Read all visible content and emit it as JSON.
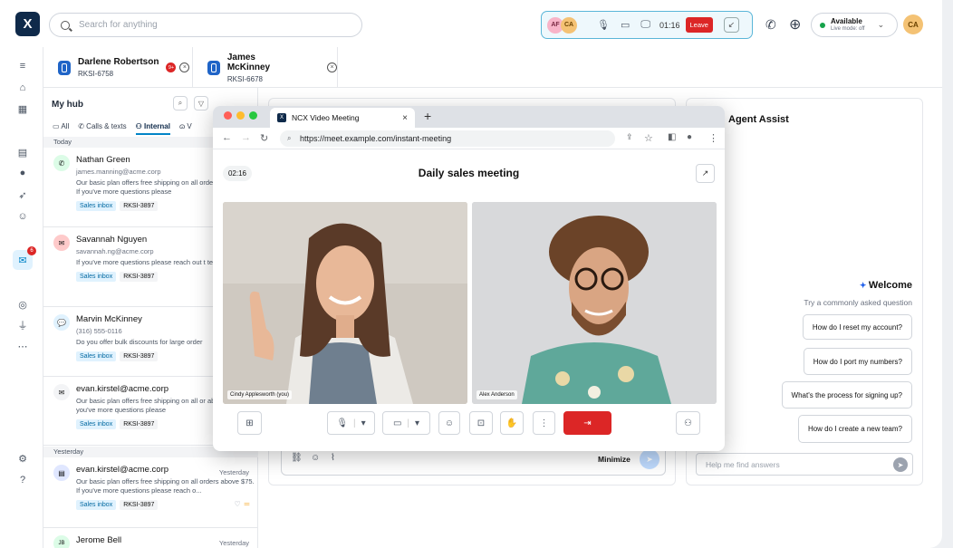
{
  "top": {
    "search_placeholder": "Search for anything",
    "call_avatars": [
      "AF",
      "CA"
    ],
    "timer": "01:16",
    "leave": "Leave",
    "status": "Available",
    "status_sub": "Live mode: off",
    "me": "CA",
    "logo": "X"
  },
  "rail": {
    "badge": "6"
  },
  "contacts": [
    {
      "name": "Darlene Robertson",
      "id": "RKSI-6758",
      "notif": "9+"
    },
    {
      "name": "James McKinney",
      "id": "RKSI-6678"
    }
  ],
  "hub": {
    "title": "My hub",
    "filters": [
      "All",
      "Calls & texts",
      "Internal",
      "V"
    ],
    "today": "Today",
    "yesterday": "Yesterday",
    "items": [
      {
        "name": "Nathan Green",
        "meta": "james.manning@acme.corp",
        "body": "Our basic plan offers free shipping on all orders above $75. If you've more questions please",
        "tags": [
          "Sales inbox",
          "RKSI-3897"
        ],
        "color": "#dcfce7"
      },
      {
        "name": "Savannah Nguyen",
        "meta": "savannah.ng@acme.corp",
        "body": "If you've more questions please reach out t team anytime.",
        "tags": [
          "Sales inbox",
          "RKSI-3897"
        ],
        "color": "#fecaca"
      },
      {
        "name": "Marvin McKinney",
        "meta": "(316) 555-0116",
        "body": "Do you offer bulk discounts for large order",
        "tags": [
          "Sales inbox",
          "RKSI-3897"
        ],
        "color": "#e0f2fe"
      },
      {
        "name": "evan.kirstel@acme.corp",
        "meta": "",
        "body": "Our basic plan offers free shipping on all or above $75. If you've more questions please",
        "tags": [
          "Sales inbox",
          "RKSI-3897"
        ],
        "color": "#f3f4f6"
      },
      {
        "name": "evan.kirstel@acme.corp",
        "time": "Yesterday",
        "meta": "",
        "body": "Our basic plan offers free shipping on all orders above $75. If you've more questions please reach o...",
        "tags": [
          "Sales inbox",
          "RKSI-3897"
        ],
        "color": "#e0e7ff"
      },
      {
        "name": "Jerome Bell",
        "time": "Yesterday",
        "meta": "",
        "body": "",
        "tags": [],
        "color": "#dcfce7"
      }
    ]
  },
  "meeting": {
    "tab": "NCX Video Meeting",
    "url": "https://meet.example.com/instant-meeting",
    "timer": "02:16",
    "title": "Daily sales meeting",
    "p1": "Cindy Applesworth (you)",
    "p2": "Alex Anderson"
  },
  "composer": {
    "minimize": "Minimize"
  },
  "assist": {
    "title": "Agent Assist",
    "welcome": "Welcome",
    "try": "Try a commonly asked question",
    "questions": [
      "How do I reset my account?",
      "How do I port my numbers?",
      "What's the process for signing up?",
      "How do I create a new team?"
    ],
    "placeholder": "Help me find answers"
  }
}
